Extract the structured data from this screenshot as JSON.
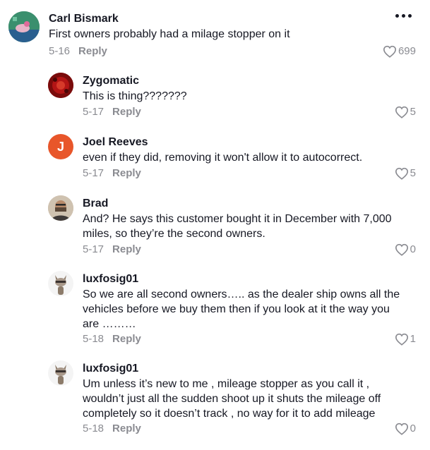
{
  "comments": [
    {
      "author": "Carl Bismark",
      "text": "First owners probably had a milage stopper on it",
      "date": "5-16",
      "reply_label": "Reply",
      "likes": "699",
      "avatar_icon": "game-character-avatar"
    },
    {
      "author": "Zygomatic",
      "text": "This is thing???????",
      "date": "5-17",
      "reply_label": "Reply",
      "likes": "5",
      "avatar_icon": "red-pattern-avatar"
    },
    {
      "author": "Joel Reeves",
      "text": "even if they did, removing it won't allow it to autocorrect.",
      "date": "5-17",
      "reply_label": "Reply",
      "likes": "5",
      "avatar_letter": "J",
      "avatar_color": "#e8562a"
    },
    {
      "author": "Brad",
      "text": "And? He says this customer bought it in December with 7,000 miles, so they’re the second owners.",
      "date": "5-17",
      "reply_label": "Reply",
      "likes": "0",
      "avatar_icon": "man-photo-avatar"
    },
    {
      "author": "luxfosig01",
      "text": "So we are all second owners….. as the dealer ship owns all the vehicles before we buy them then if you look at it the way you are ………",
      "date": "5-18",
      "reply_label": "Reply",
      "likes": "1",
      "avatar_icon": "cartoon-raccoon-avatar"
    },
    {
      "author": "luxfosig01",
      "text": "Um unless it’s new to me , mileage stopper as you call it , wouldn’t just all the sudden shoot up it shuts the mileage off completely so it doesn’t track , no way for it to add mileage",
      "date": "5-18",
      "reply_label": "Reply",
      "likes": "0",
      "avatar_icon": "cartoon-raccoon-avatar"
    }
  ],
  "colors": {
    "primary_text": "#161823",
    "secondary_text": "#8a8b91",
    "background": "#ffffff"
  }
}
